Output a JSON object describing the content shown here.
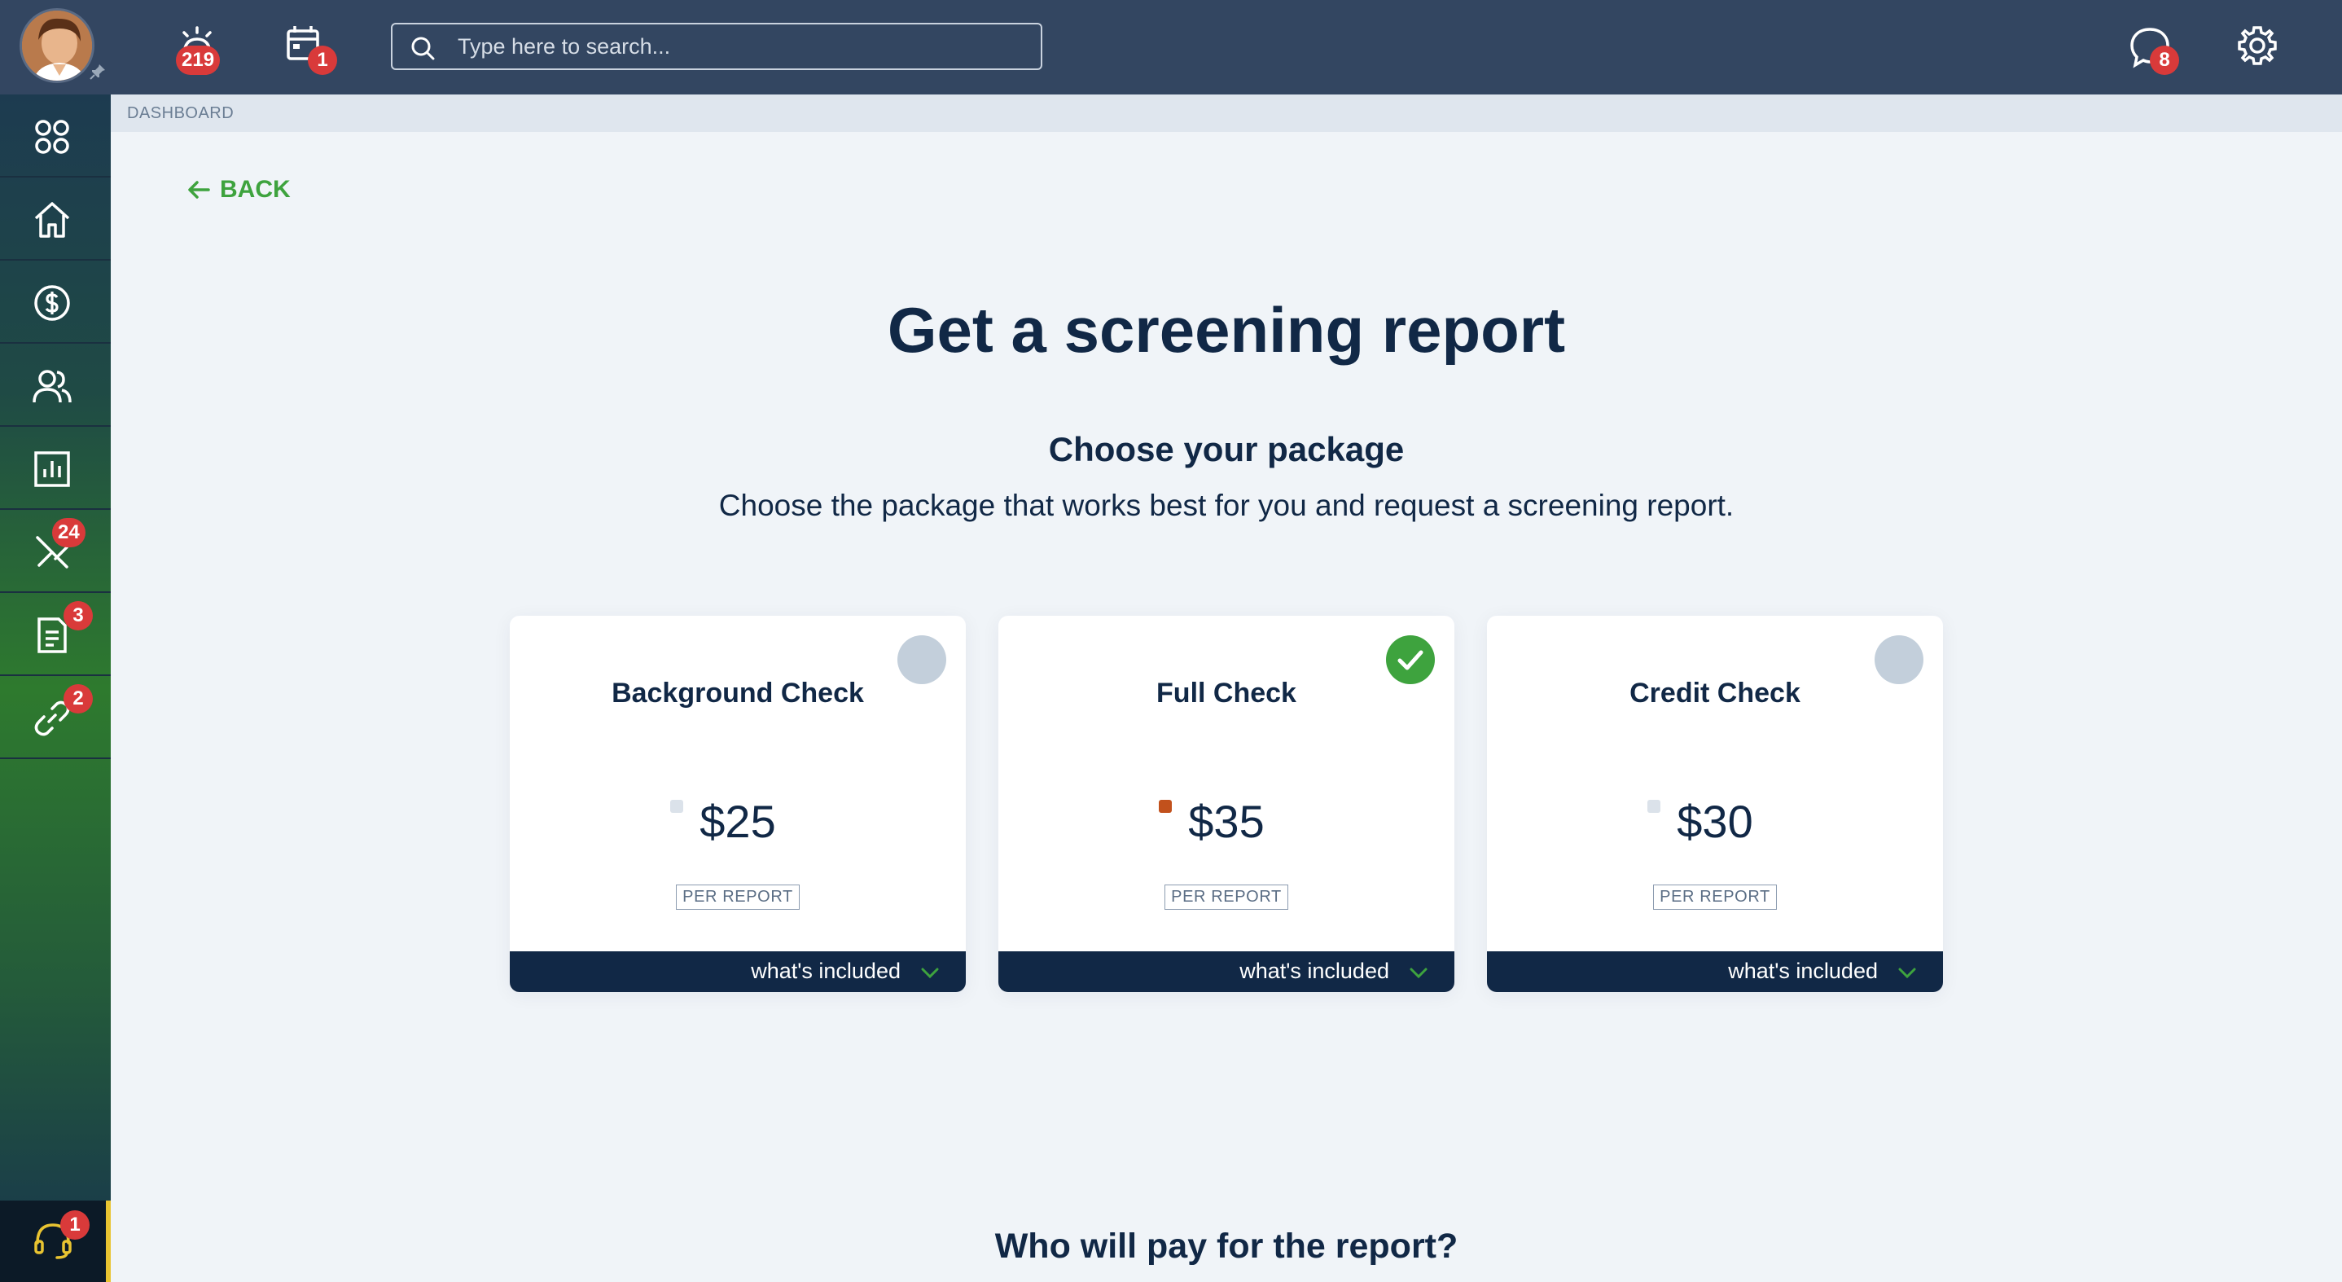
{
  "header": {
    "search_placeholder": "Type here to search...",
    "alerts_count": "219",
    "calendar_count": "1",
    "messages_count": "8"
  },
  "sidebar": {
    "items": [
      {
        "icon": "grid-icon"
      },
      {
        "icon": "home-icon"
      },
      {
        "icon": "dollar-icon"
      },
      {
        "icon": "people-icon"
      },
      {
        "icon": "chart-icon"
      },
      {
        "icon": "tools-icon",
        "badge": "24"
      },
      {
        "icon": "document-icon",
        "badge": "3"
      },
      {
        "icon": "link-icon",
        "badge": "2"
      }
    ],
    "support_badge": "1"
  },
  "breadcrumb": "DASHBOARD",
  "back_label": "BACK",
  "title": "Get a screening report",
  "section_title": "Choose your package",
  "section_subtitle": "Choose the package that works best for you and request a screening report.",
  "packages": [
    {
      "name": "Background Check",
      "price": "$25",
      "unit": "PER REPORT",
      "footer": "what's included",
      "selected": false
    },
    {
      "name": "Full Check",
      "price": "$35",
      "unit": "PER REPORT",
      "footer": "what's included",
      "selected": true
    },
    {
      "name": "Credit Check",
      "price": "$30",
      "unit": "PER REPORT",
      "footer": "what's included",
      "selected": false
    }
  ],
  "payer_title": "Who will pay for the report?",
  "colors": {
    "topbar": "#334661",
    "accent_green": "#3ea33e",
    "navy": "#112846",
    "badge_red": "#d93a3a",
    "selected_dot": "#c2511c"
  }
}
